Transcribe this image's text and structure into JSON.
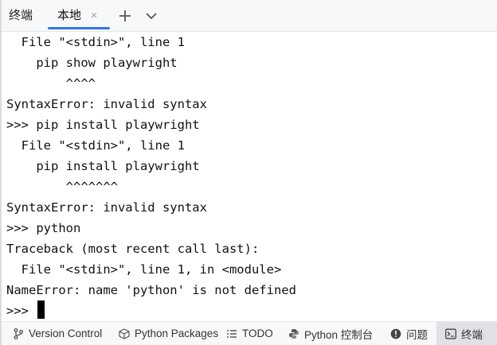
{
  "tab_bar": {
    "tool_title": "终端",
    "active_tab_label": "本地",
    "close_glyph": "×"
  },
  "terminal": {
    "lines": [
      "  File \"<stdin>\", line 1",
      "    pip show playwright",
      "        ^^^^",
      "SyntaxError: invalid syntax",
      ">>> pip install playwright",
      "  File \"<stdin>\", line 1",
      "    pip install playwright",
      "        ^^^^^^^",
      "SyntaxError: invalid syntax",
      ">>> python",
      "Traceback (most recent call last):",
      "  File \"<stdin>\", line 1, in <module>",
      "NameError: name 'python' is not defined",
      ">>> "
    ]
  },
  "bottom_bar": {
    "items": [
      {
        "label": "Version Control",
        "icon": "version-control-icon"
      },
      {
        "label": "Python Packages",
        "icon": "python-packages-icon"
      },
      {
        "label": "TODO",
        "icon": "todo-list-icon"
      },
      {
        "label": "Python 控制台",
        "icon": "python-console-icon"
      },
      {
        "label": "问题",
        "icon": "problems-icon"
      },
      {
        "label": "终端",
        "icon": "terminal-icon"
      }
    ]
  },
  "colors": {
    "accent": "#3574f0",
    "toolbar_bg": "#f7f8fa",
    "active_tool_bg": "#dfe1e5"
  }
}
